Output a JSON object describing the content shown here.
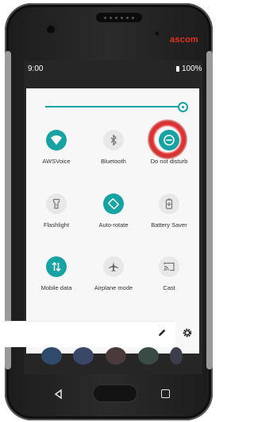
{
  "device": {
    "brand": "ascom"
  },
  "statusbar": {
    "time": "9:00",
    "battery": "100%"
  },
  "quick_settings": {
    "brightness_level": 0.98,
    "tiles": [
      {
        "label": "AWSVoice",
        "icon": "wifi-icon",
        "state": "on"
      },
      {
        "label": "Bluetooth",
        "icon": "bluetooth-icon",
        "state": "off"
      },
      {
        "label": "Do not disturb",
        "icon": "do-not-disturb-icon",
        "state": "on"
      },
      {
        "label": "Flashlight",
        "icon": "flashlight-icon",
        "state": "off"
      },
      {
        "label": "Auto-rotate",
        "icon": "auto-rotate-icon",
        "state": "on"
      },
      {
        "label": "Battery Saver",
        "icon": "battery-saver-icon",
        "state": "off"
      },
      {
        "label": "Mobile data",
        "icon": "mobile-data-icon",
        "state": "on"
      },
      {
        "label": "Airplane mode",
        "icon": "airplane-icon",
        "state": "off"
      },
      {
        "label": "Cast",
        "icon": "cast-icon",
        "state": "off"
      }
    ],
    "footer": {
      "edit_icon": "pencil-icon",
      "settings_icon": "gear-icon"
    }
  },
  "navigation": {
    "back": "back-icon",
    "home": "home-button",
    "recents": "recents-icon"
  },
  "colors": {
    "accent": "#17a2a4",
    "brand": "#e5301f",
    "highlight": "#e02828"
  }
}
